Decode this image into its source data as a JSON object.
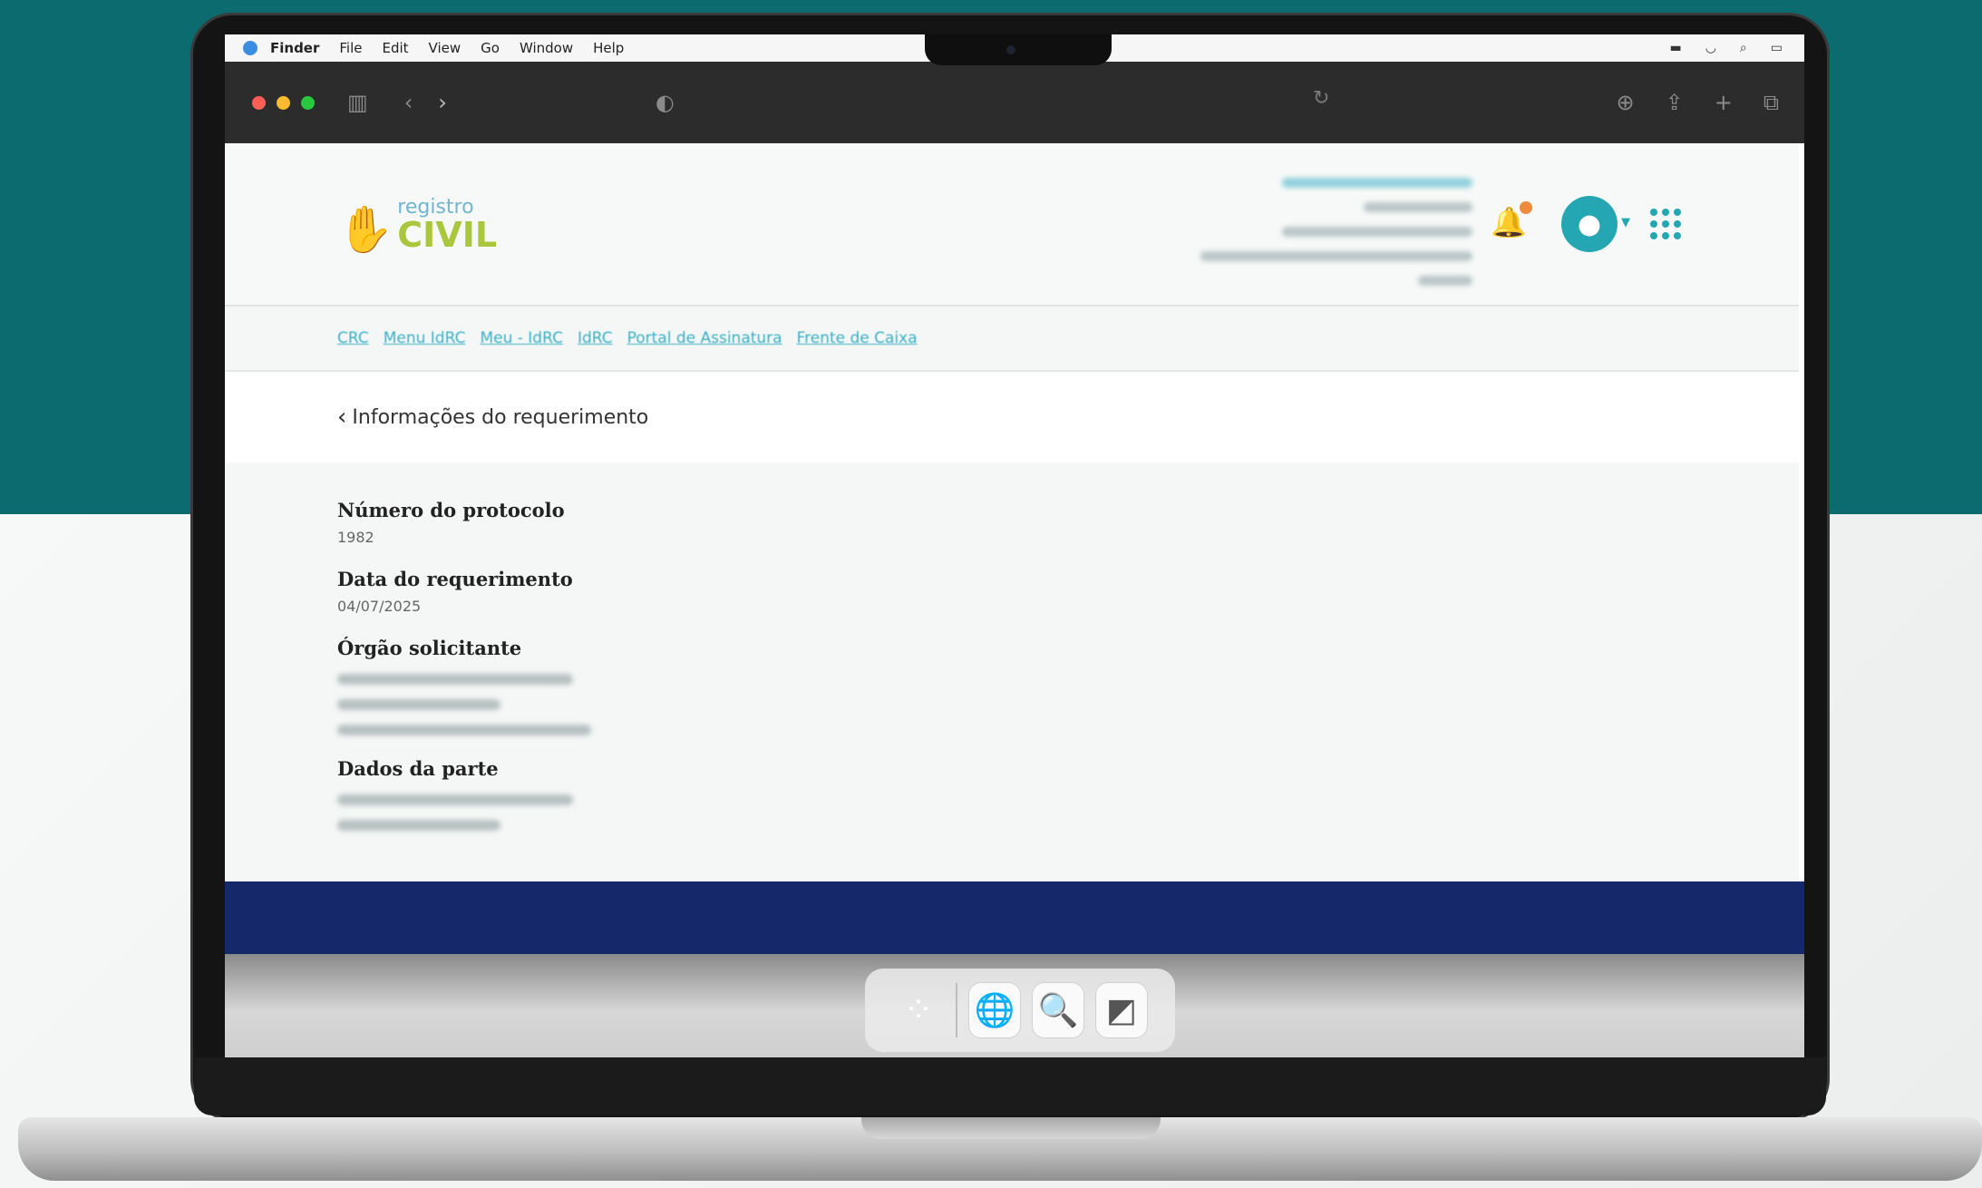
{
  "menubar": {
    "app": "Finder",
    "items": [
      "File",
      "Edit",
      "View",
      "Go",
      "Window",
      "Help"
    ]
  },
  "browser": {
    "traffic_lights": [
      "#ff5f57",
      "#febc2e",
      "#28c840"
    ]
  },
  "site": {
    "logo_small": "registro",
    "logo_big": "CIVIL",
    "nav_links": [
      "CRC",
      "Menu IdRC",
      "Meu - IdRC",
      "IdRC",
      "Portal de Assinatura",
      "Frente de Caixa"
    ]
  },
  "page": {
    "title": "Informações do requerimento",
    "fields": [
      {
        "label": "Número do protocolo",
        "value": "1982"
      },
      {
        "label": "Data do requerimento",
        "value": "04/07/2025"
      },
      {
        "label": "Órgão solicitante"
      },
      {
        "label": "Dados da parte"
      }
    ]
  },
  "colors": {
    "teal_bg": "#0c6b6e",
    "accent": "#25a7b3",
    "footer": "#15296a"
  }
}
